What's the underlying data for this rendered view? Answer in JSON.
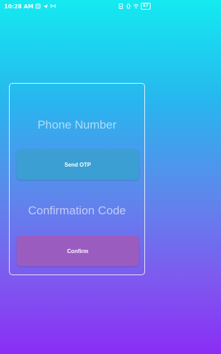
{
  "status_bar": {
    "time": "10:28 AM",
    "battery": "67",
    "icons": [
      "notification-icon",
      "telegram-icon",
      "gmail-icon",
      "sim-icon",
      "vibrate-icon",
      "wifi-icon",
      "battery-icon"
    ]
  },
  "form": {
    "phone_placeholder": "Phone Number",
    "send_otp_label": "Send OTP",
    "code_placeholder": "Confirmation Code",
    "confirm_label": "Confirm"
  },
  "colors": {
    "gradient_top": "#14eaf0",
    "gradient_bottom": "#8b2df5",
    "send_otp_button": "#3b9fd3",
    "confirm_button": "#9b5cc0"
  }
}
